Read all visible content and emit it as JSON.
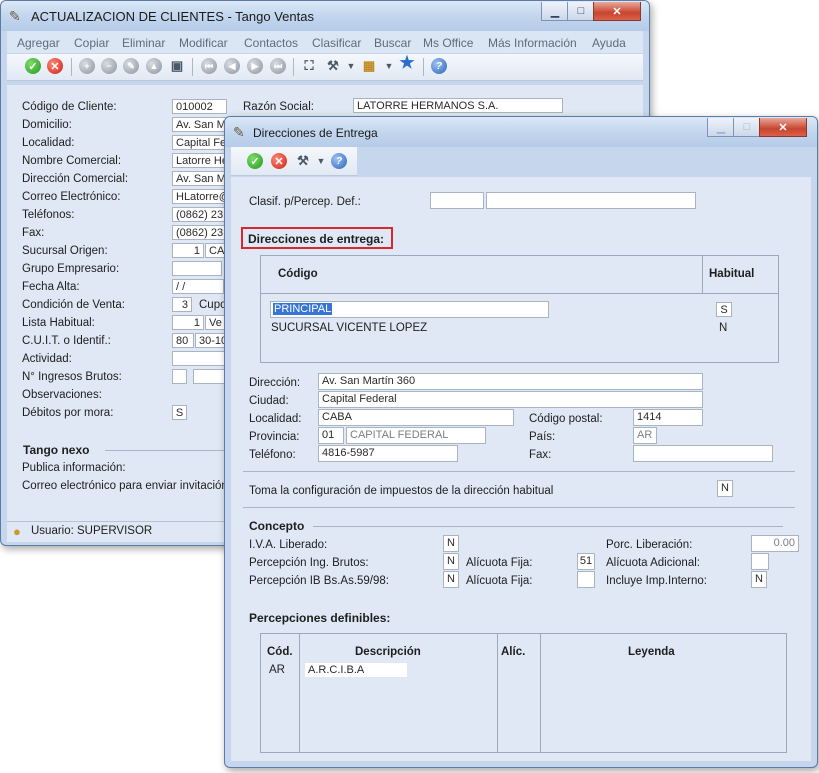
{
  "main_window": {
    "title": "ACTUALIZACION DE CLIENTES - Tango Ventas",
    "menu": [
      "Agregar",
      "Copiar",
      "Eliminar",
      "Modificar",
      "Contactos",
      "Clasificar",
      "Buscar",
      "Ms Office",
      "Más Información",
      "Ayuda"
    ],
    "fields": {
      "codigo_cliente": {
        "label": "Código de Cliente:",
        "value": "010002"
      },
      "razon_social": {
        "label": "Razón Social:",
        "value": "LATORRE HERMANOS S.A."
      },
      "domicilio": {
        "label": "Domicilio:",
        "value": "Av. San M"
      },
      "localidad": {
        "label": "Localidad:",
        "value": "Capital Fede"
      },
      "nombre_comercial": {
        "label": "Nombre Comercial:",
        "value": "Latorre He"
      },
      "direccion_comercial": {
        "label": "Dirección Comercial:",
        "value": "Av. San M"
      },
      "correo": {
        "label": "Correo Electrónico:",
        "value": "HLatorre@"
      },
      "telefonos": {
        "label": "Teléfonos:",
        "value": "(0862) 231"
      },
      "fax": {
        "label": "Fax:",
        "value": "(0862) 231"
      },
      "sucursal_origen": {
        "label": "Sucursal Origen:",
        "value": "1",
        "value2": "CA"
      },
      "grupo_empresario": {
        "label": "Grupo Empresario:"
      },
      "fecha_alta": {
        "label": "Fecha Alta:",
        "value": " /  /"
      },
      "condicion_venta": {
        "label": "Condición de Venta:",
        "value": "3",
        "value2": "Cupo"
      },
      "lista_habitual": {
        "label": "Lista Habitual:",
        "value": "1",
        "value2": "Ve"
      },
      "cuit": {
        "label": "C.U.I.T. o Identif.:",
        "value": "80",
        "value2": "30-10"
      },
      "actividad": {
        "label": "Actividad:"
      },
      "ingresos_brutos": {
        "label": "N° Ingresos Brutos:"
      },
      "observaciones": {
        "label": "Observaciones:"
      },
      "debitos_mora": {
        "label": "Débitos por mora:",
        "value": "S"
      }
    },
    "tango_nexo": {
      "title": "Tango nexo",
      "publica": "Publica información:",
      "correo_invitacion": "Correo electrónico para enviar invitación:"
    },
    "status": "Usuario: SUPERVISOR"
  },
  "dialog": {
    "title": "Direcciones de Entrega",
    "clasif_label": "Clasif. p/Percep. Def.:",
    "section_title": "Direcciones de entrega:",
    "grid": {
      "col_codigo": "Código",
      "col_habitual": "Habitual",
      "rows": [
        {
          "codigo": "PRINCIPAL",
          "habitual": "S"
        },
        {
          "codigo": "SUCURSAL VICENTE LOPEZ",
          "habitual": "N"
        }
      ]
    },
    "direccion": {
      "label": "Dirección:",
      "value": "Av. San Martín 360"
    },
    "ciudad": {
      "label": "Ciudad:",
      "value": "Capital Federal"
    },
    "localidad": {
      "label": "Localidad:",
      "value": "CABA"
    },
    "codigo_postal": {
      "label": "Código postal:",
      "value": "1414"
    },
    "provincia": {
      "label": "Provincia:",
      "code": "01",
      "name": "CAPITAL FEDERAL"
    },
    "pais": {
      "label": "País:",
      "value": "AR"
    },
    "telefono": {
      "label": "Teléfono:",
      "value": "4816-5987"
    },
    "fax": {
      "label": "Fax:",
      "value": ""
    },
    "toma_config": {
      "label": "Toma la configuración de impuestos de la dirección habitual",
      "value": "N"
    },
    "concepto": {
      "title": "Concepto",
      "iva_liberado": {
        "label": "I.V.A. Liberado:",
        "value": "N"
      },
      "porc_liberacion": {
        "label": "Porc. Liberación:",
        "value": "0.00"
      },
      "percep_ing_brutos": {
        "label": "Percepción Ing. Brutos:",
        "value": "N"
      },
      "alicuota_fija_1": {
        "label": "Alícuota Fija:",
        "value": "51"
      },
      "alicuota_adicional": {
        "label": "Alícuota Adicional:",
        "value": ""
      },
      "percep_ib_bsas": {
        "label": "Percepción IB Bs.As.59/98:",
        "value": "N"
      },
      "alicuota_fija_2": {
        "label": "Alícuota Fija:",
        "value": ""
      },
      "incluye_imp": {
        "label": "Incluye Imp.Interno:",
        "value": "N"
      }
    },
    "percepciones": {
      "title": "Percepciones definibles:",
      "col_cod": "Cód.",
      "col_desc": "Descripción",
      "col_alic": "Alíc.",
      "col_leyenda": "Leyenda",
      "rows": [
        {
          "cod": "AR",
          "desc": "A.R.C.I.B.A"
        }
      ]
    }
  },
  "colors": {
    "highlight": "#d8282d",
    "selection": "#3875d7"
  }
}
